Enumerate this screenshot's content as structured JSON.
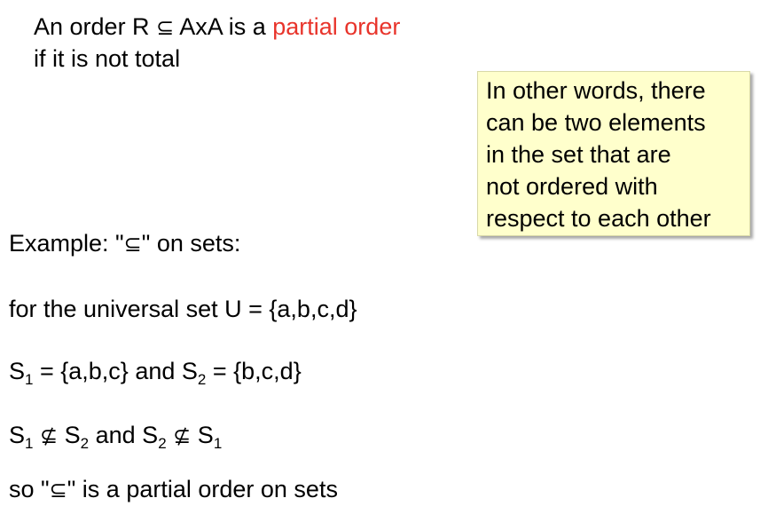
{
  "definition": {
    "line1_prefix": "An order R",
    "subset_symbol": "⊆",
    "line1_middle": "AxA is a ",
    "line1_highlight": "partial order",
    "line2": "if it is not total"
  },
  "note": {
    "lines": [
      "In other words, there",
      "can be two elements",
      "in the set that are",
      "not ordered with",
      "respect to each other"
    ]
  },
  "example": {
    "intro_prefix": "Example: \"",
    "intro_symbol": "⊆",
    "intro_suffix": "\" on sets:",
    "universal": "for the universal set U = {a,b,c,d}",
    "s_letter": "S",
    "sub1": "1",
    "sub2": "2",
    "s1_value": " = {a,b,c} and ",
    "s2_value": " = {b,c,d}",
    "not_subset_symbol": "⊈",
    "and_text": " and ",
    "conclusion_prefix": "so \"",
    "conclusion_symbol": "⊆",
    "conclusion_suffix": "\" is a partial order on sets"
  },
  "colors": {
    "highlight": "#e8342b",
    "note_background": "#ffffcc"
  }
}
